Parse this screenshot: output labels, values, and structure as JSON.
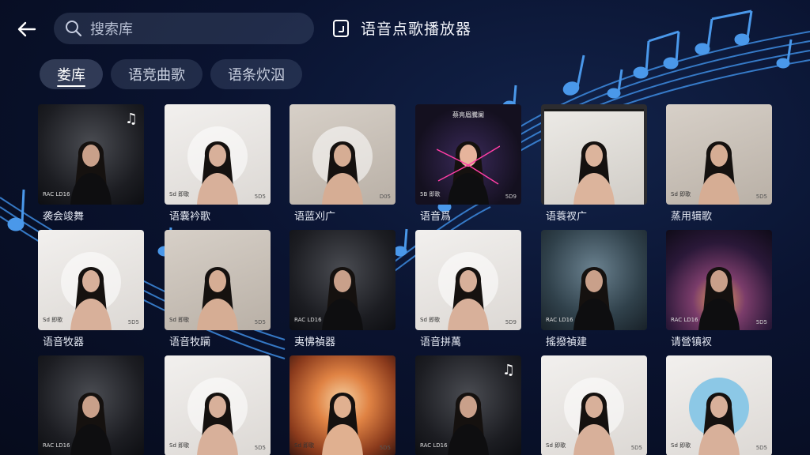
{
  "header": {
    "search_placeholder": "搜索库",
    "app_title": "语音点歌播放器"
  },
  "tabs": [
    {
      "label": "娄库",
      "active": true
    },
    {
      "label": "语竞曲歌",
      "active": false
    },
    {
      "label": "语条炊泅",
      "active": false
    }
  ],
  "albums": [
    {
      "label": "袭会竣舞",
      "style": "dark",
      "cover_text": "RAC LD16",
      "badge": "♫",
      "num": ""
    },
    {
      "label": "语囊衿歌",
      "style": "light",
      "cover_text": "Sd 即歌",
      "num": "5D5"
    },
    {
      "label": "语蓝刈广",
      "style": "beige",
      "cover_text": "",
      "num": "D05"
    },
    {
      "label": "语音爲",
      "style": "neon",
      "cover_text": "5B 即歌",
      "header": "蔡亮眉騰阑",
      "num": "5D9"
    },
    {
      "label": "语蓑衩广",
      "style": "frame",
      "cover_text": "",
      "num": ""
    },
    {
      "label": "蒸用辑歌",
      "style": "beige",
      "cover_text": "Sd 即歌",
      "num": "5D5"
    },
    {
      "label": "语音牧器",
      "style": "light",
      "cover_text": "Sd 即歌",
      "num": "5D5"
    },
    {
      "label": "语音牧躏",
      "style": "beige",
      "cover_text": "Sd 即歌",
      "num": "5D5"
    },
    {
      "label": "夷怫禎器",
      "style": "dark",
      "cover_text": "RAC LD16",
      "num": ""
    },
    {
      "label": "语音拼萬",
      "style": "light",
      "cover_text": "Sd 即歌",
      "num": "5D9"
    },
    {
      "label": "搖撥禎建",
      "style": "teal",
      "cover_text": "RAC LD16",
      "num": ""
    },
    {
      "label": "请營镇衩",
      "style": "cosmic",
      "cover_text": "RAC LD16",
      "num": "5D5"
    },
    {
      "label": "",
      "style": "dark",
      "cover_text": "RAC LD16",
      "num": ""
    },
    {
      "label": "",
      "style": "light",
      "cover_text": "Sd 即歌",
      "num": "5D5"
    },
    {
      "label": "",
      "style": "warm",
      "cover_text": "Sd 即歌",
      "num": "5D5"
    },
    {
      "label": "",
      "style": "dark",
      "cover_text": "RAC LD16",
      "badge": "♫",
      "num": ""
    },
    {
      "label": "",
      "style": "light",
      "cover_text": "Sd 即歌",
      "num": "5D5"
    },
    {
      "label": "",
      "style": "light",
      "cover_text": "Sd 即歌",
      "num": "5D5"
    }
  ],
  "colors": {
    "background": "#0a1330",
    "accent_notes": "#3d8be0",
    "pill_bg": "#2a3552"
  }
}
